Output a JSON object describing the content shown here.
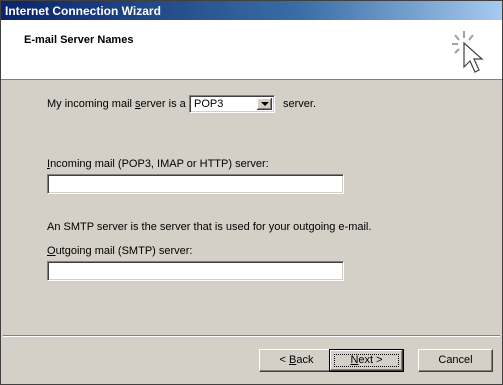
{
  "window": {
    "title": "Internet Connection Wizard"
  },
  "header": {
    "title": "E-mail Server Names",
    "icon": "wizard-sparkle-cursor-icon"
  },
  "form": {
    "incoming_type_label_pre": "My incoming mail ",
    "incoming_type_label_accel": "s",
    "incoming_type_label_post": "erver is a",
    "incoming_type_value": "POP3",
    "incoming_type_suffix": "server.",
    "incoming_server_label_accel": "I",
    "incoming_server_label_rest": "ncoming mail (POP3, IMAP or HTTP) server:",
    "incoming_server_value": "",
    "smtp_description": "An SMTP server is the server that is used for your outgoing e-mail.",
    "outgoing_server_label_accel": "O",
    "outgoing_server_label_rest": "utgoing mail (SMTP) server:",
    "outgoing_server_value": ""
  },
  "buttons": {
    "back_pre": "< ",
    "back_accel": "B",
    "back_post": "ack",
    "next_pre": "",
    "next_accel": "N",
    "next_post": "ext >",
    "cancel": "Cancel"
  }
}
